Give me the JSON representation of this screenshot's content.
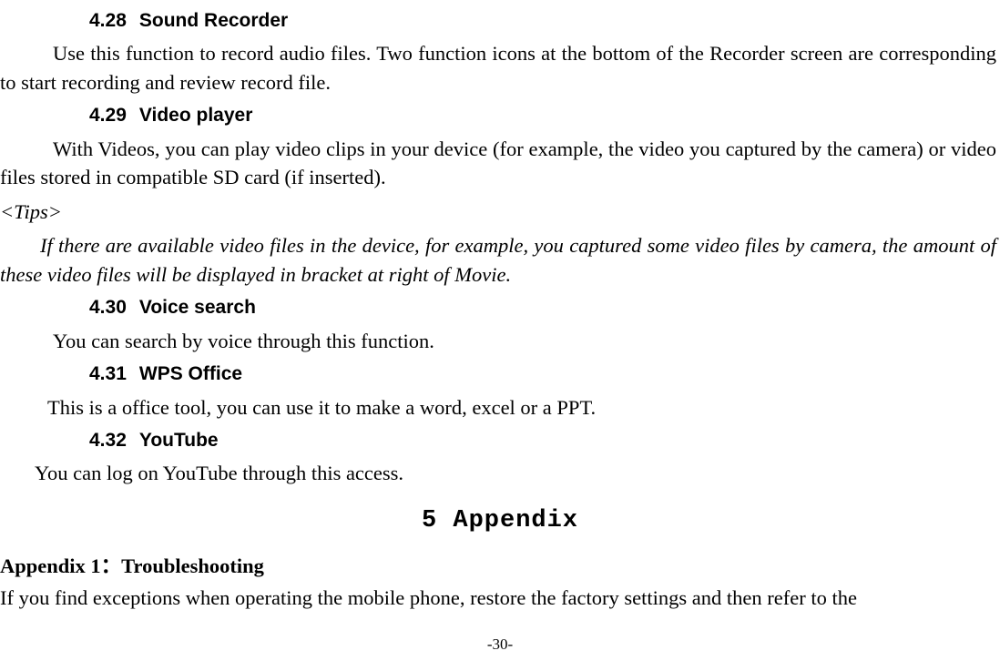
{
  "sections": {
    "s428": {
      "num": "4.28",
      "title": "Sound Recorder"
    },
    "p428": "Use this function to record audio files. Two function icons at the bottom of the Recorder screen are corresponding to start recording and review record file.",
    "s429": {
      "num": "4.29",
      "title": "Video player"
    },
    "p429": "With Videos, you can play video clips in your device (for example, the video you captured by the camera) or video files stored in compatible SD card (if inserted).",
    "tipsLabel": "<Tips>",
    "tipsBody": "If there are available video files in the device, for example, you captured some video files by camera, the amount of these video files will be displayed in bracket at right of Movie.",
    "s430": {
      "num": "4.30",
      "title": "Voice search"
    },
    "p430": "You can search by voice through this function.",
    "s431": {
      "num": "4.31",
      "title": "WPS Office"
    },
    "p431": "This is a office tool, you can use it to make a word, excel or a PPT.",
    "s432": {
      "num": "4.32",
      "title": "YouTube"
    },
    "p432": "You can log on YouTube through this access."
  },
  "appendix": {
    "title": "5 Appendix",
    "sub": "Appendix 1：Troubleshooting",
    "body": "If you find exceptions when operating the mobile phone, restore the factory settings and then refer to the"
  },
  "footer": "-30-"
}
